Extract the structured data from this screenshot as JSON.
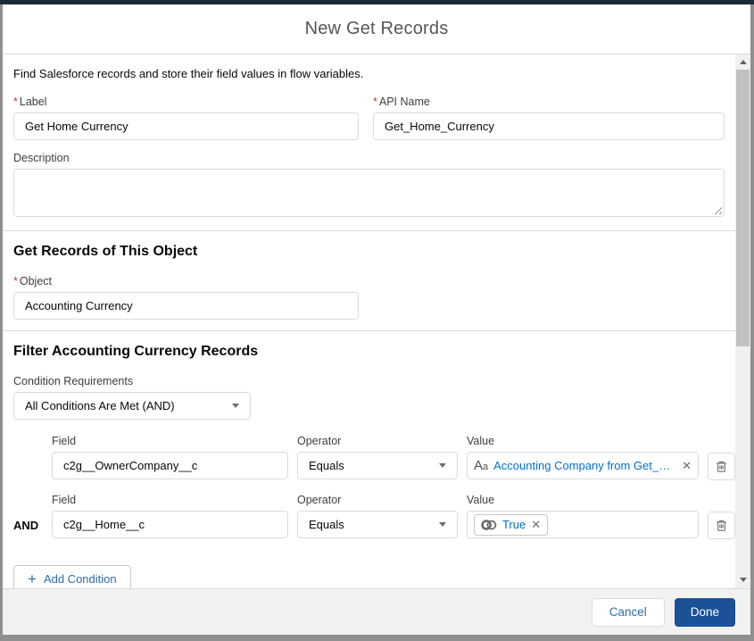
{
  "modal": {
    "title": "New Get Records",
    "intro": "Find Salesforce records and store their field values in flow variables.",
    "required_marker": "*",
    "fields": {
      "label": {
        "label": "Label",
        "value": "Get Home Currency"
      },
      "api_name": {
        "label": "API Name",
        "value": "Get_Home_Currency"
      },
      "description": {
        "label": "Description",
        "value": ""
      }
    },
    "object_section": {
      "heading": "Get Records of This Object",
      "object_label": "Object",
      "object_value": "Accounting Currency"
    },
    "filter_section": {
      "heading": "Filter Accounting Currency Records",
      "condition_requirements_label": "Condition Requirements",
      "condition_requirements_value": "All Conditions Are Met (AND)",
      "column_labels": {
        "field": "Field",
        "operator": "Operator",
        "value": "Value"
      },
      "rows": [
        {
          "connector": "",
          "field": "c2g__OwnerCompany__c",
          "operator": "Equals",
          "value": "Accounting Company from Get_…",
          "value_icon": "text-icon"
        },
        {
          "connector": "AND",
          "field": "c2g__Home__c",
          "operator": "Equals",
          "value": "True",
          "value_icon": "toggle-icon"
        }
      ],
      "add_condition_label": "Add Condition"
    },
    "footer": {
      "cancel_label": "Cancel",
      "done_label": "Done"
    }
  },
  "icons": {
    "close": "✕",
    "plus": "+",
    "text_icon_big": "A",
    "text_icon_small": "a"
  },
  "colors": {
    "link_blue": "#0070d2",
    "button_text_blue": "#2e6ca9",
    "done_button_blue": "#1b5297",
    "required_red": "#c23934",
    "border_gray": "#dddbda",
    "label_gray": "#3e3e3c",
    "footer_gray": "#f3f2f2",
    "backdrop_top_navy": "#1c2936",
    "backdrop_gray": "#8f8f8f"
  }
}
